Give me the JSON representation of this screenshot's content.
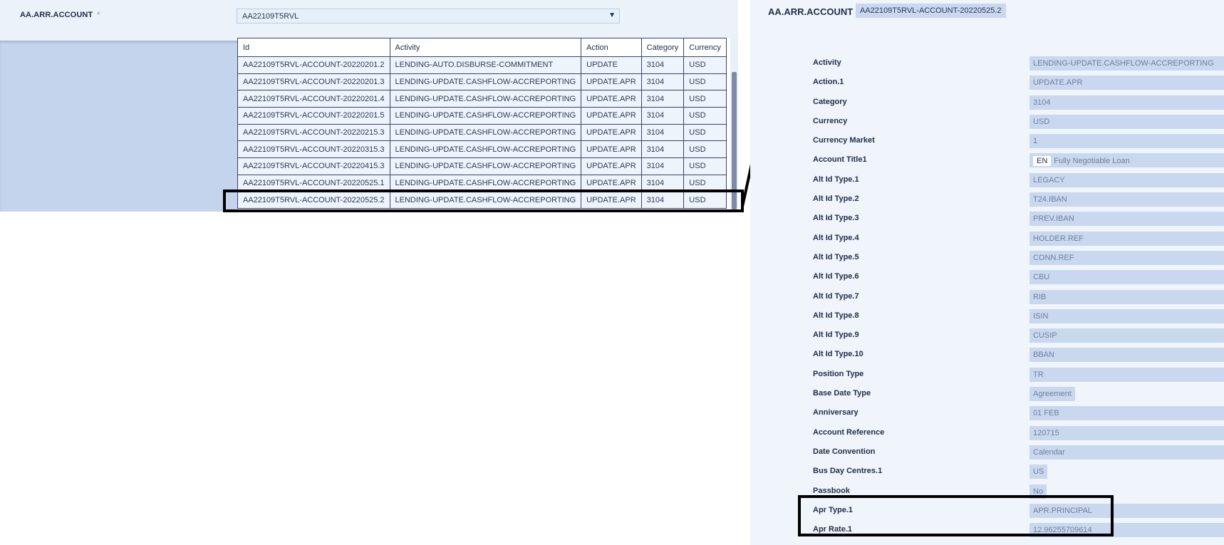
{
  "left": {
    "field_label": "AA.ARR.ACCOUNT",
    "required_mark": "*",
    "dropdown_value": "AA22109T5RVL",
    "dropdown_arrow": "▼",
    "grid": {
      "columns": [
        "Id",
        "Activity",
        "Action",
        "Category",
        "Currency"
      ],
      "rows": [
        [
          "AA22109T5RVL-ACCOUNT-20220201.2",
          "LENDING-AUTO.DISBURSE-COMMITMENT",
          "UPDATE",
          "3104",
          "USD"
        ],
        [
          "AA22109T5RVL-ACCOUNT-20220201.3",
          "LENDING-UPDATE.CASHFLOW-ACCREPORTING",
          "UPDATE.APR",
          "3104",
          "USD"
        ],
        [
          "AA22109T5RVL-ACCOUNT-20220201.4",
          "LENDING-UPDATE.CASHFLOW-ACCREPORTING",
          "UPDATE.APR",
          "3104",
          "USD"
        ],
        [
          "AA22109T5RVL-ACCOUNT-20220201.5",
          "LENDING-UPDATE.CASHFLOW-ACCREPORTING",
          "UPDATE.APR",
          "3104",
          "USD"
        ],
        [
          "AA22109T5RVL-ACCOUNT-20220215.3",
          "LENDING-UPDATE.CASHFLOW-ACCREPORTING",
          "UPDATE.APR",
          "3104",
          "USD"
        ],
        [
          "AA22109T5RVL-ACCOUNT-20220315.3",
          "LENDING-UPDATE.CASHFLOW-ACCREPORTING",
          "UPDATE.APR",
          "3104",
          "USD"
        ],
        [
          "AA22109T5RVL-ACCOUNT-20220415.3",
          "LENDING-UPDATE.CASHFLOW-ACCREPORTING",
          "UPDATE.APR",
          "3104",
          "USD"
        ],
        [
          "AA22109T5RVL-ACCOUNT-20220525.1",
          "LENDING-UPDATE.CASHFLOW-ACCREPORTING",
          "UPDATE.APR",
          "3104",
          "USD"
        ],
        [
          "AA22109T5RVL-ACCOUNT-20220525.2",
          "LENDING-UPDATE.CASHFLOW-ACCREPORTING",
          "UPDATE.APR",
          "3104",
          "USD"
        ]
      ]
    }
  },
  "right": {
    "title": "AA.ARR.ACCOUNT",
    "record_id": "AA22109T5RVL-ACCOUNT-20220525.2",
    "fields": [
      {
        "label": "Activity",
        "value": "LENDING-UPDATE.CASHFLOW-ACCREPORTING"
      },
      {
        "label": "Action.1",
        "value": "UPDATE.APR"
      },
      {
        "label": "Category",
        "value": "3104"
      },
      {
        "label": "Currency",
        "value": "USD"
      },
      {
        "label": "Currency Market",
        "value": "1"
      },
      {
        "label": "Account Title1",
        "lang": "EN",
        "value": "Fully Negotiable Loan"
      },
      {
        "label": "Alt Id Type.1",
        "value": "LEGACY"
      },
      {
        "label": "Alt Id Type.2",
        "value": "T24.IBAN"
      },
      {
        "label": "Alt Id Type.3",
        "value": "PREV.IBAN"
      },
      {
        "label": "Alt Id Type.4",
        "value": "HOLDER.REF"
      },
      {
        "label": "Alt Id Type.5",
        "value": "CONN.REF"
      },
      {
        "label": "Alt Id Type.6",
        "value": "CBU"
      },
      {
        "label": "Alt Id Type.7",
        "value": "RIB"
      },
      {
        "label": "Alt Id Type.8",
        "value": "ISIN"
      },
      {
        "label": "Alt Id Type.9",
        "value": "CUSIP"
      },
      {
        "label": "Alt Id Type.10",
        "value": "BBAN"
      },
      {
        "label": "Position Type",
        "value": "TR"
      },
      {
        "label": "Base Date Type",
        "value": "Agreement",
        "short": true
      },
      {
        "label": "Anniversary",
        "value": "01 FEB"
      },
      {
        "label": "Account Reference",
        "value": "120715"
      },
      {
        "label": "Date Convention",
        "value": "Calendar"
      },
      {
        "label": "Bus Day Centres.1",
        "value": "US",
        "short": true
      },
      {
        "label": "Passbook",
        "value": "No",
        "short": true
      },
      {
        "label": "Apr Type.1",
        "value": "APR.PRINCIPAL"
      },
      {
        "label": "Apr Rate.1",
        "value": "12.96255709614"
      }
    ]
  }
}
